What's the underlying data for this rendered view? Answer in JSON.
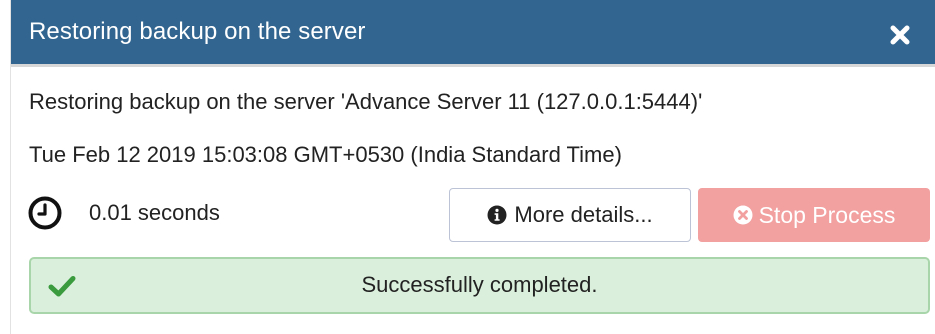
{
  "dialog": {
    "title": "Restoring backup on the server"
  },
  "process": {
    "description": "Restoring backup on the server 'Advance Server 11 (127.0.0.1:5444)'",
    "timestamp": "Tue Feb 12 2019 15:03:08 GMT+0530 (India Standard Time)",
    "elapsed": "0.01 seconds"
  },
  "buttons": {
    "more_details_label": "More details...",
    "stop_label": "Stop Process"
  },
  "status": {
    "message": "Successfully completed."
  },
  "colors": {
    "header_bg": "#326690",
    "stop_bg": "#f2a0a0",
    "success_bg": "#dbf0dc",
    "success_icon": "#3a9a3e"
  },
  "icons": {
    "close": "close-icon",
    "clock": "clock-icon",
    "info": "info-circle-icon",
    "stop": "times-circle-icon",
    "success": "check-icon"
  }
}
